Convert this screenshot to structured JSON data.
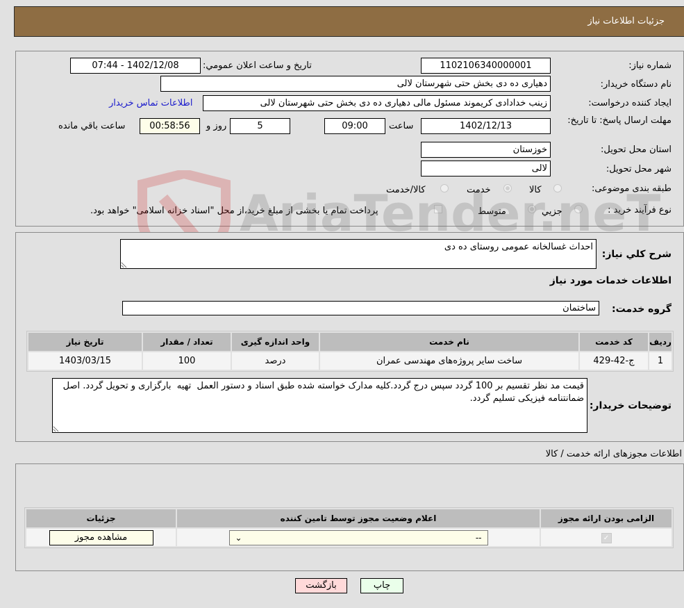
{
  "header": {
    "title": "جزئیات اطلاعات نیاز"
  },
  "details": {
    "need_number_label": "شماره نیاز:",
    "need_number": "1102106340000001",
    "announce_label": "تاریخ و ساعت اعلان عمومي:",
    "announce_value": "1402/12/08 - 07:44",
    "buyer_org_label": "نام دستگاه خریدار:",
    "buyer_org": "دهیاری ده دی بخش حتی شهرستان لالی",
    "creator_label": "ایجاد کننده درخواست:",
    "creator": "زینب خدادادی کریموند مسئول مالی دهیاری ده دی بخش حتی شهرستان لالی",
    "contact_link": "اطلاعات تماس خریدار",
    "deadline_label": "مهلت ارسال پاسخ: تا تاریخ:",
    "deadline_date": "1402/12/13",
    "time_label": "ساعت",
    "deadline_time": "09:00",
    "days_value": "5",
    "days_label": "روز و",
    "remaining_time": "00:58:56",
    "remaining_label": "ساعت باقي مانده",
    "province_label": "استان محل تحویل:",
    "province": "خوزستان",
    "city_label": "شهر محل تحویل:",
    "city": "لالی",
    "category_label": "طبقه بندی موضوعی:",
    "category_options": [
      "کالا",
      "خدمت",
      "کالا/خدمت"
    ],
    "category_selected": "خدمت",
    "process_label": "نوع فرآیند خرید :",
    "process_options": [
      "جزيي",
      "متوسط"
    ],
    "process_selected": "متوسط",
    "treasury_note": "پرداخت تمام یا بخشی از مبلغ خرید،از محل \"اسناد خزانه اسلامی\" خواهد بود."
  },
  "description": {
    "label": "شرح كلي نياز:",
    "value": "احداث غسالخانه عمومی روستای ده دی"
  },
  "services": {
    "section_title": "اطلاعات خدمات مورد نیاز",
    "group_label": "گروه خدمت:",
    "group_value": "ساختمان",
    "columns": [
      "ردیف",
      "کد خدمت",
      "نام خدمت",
      "واحد اندازه گیری",
      "تعداد / مقدار",
      "تاریخ نیاز"
    ],
    "rows": [
      {
        "index": "1",
        "code": "ج-42-429",
        "name": "ساخت سایر پروژه‌های مهندسی عمران",
        "unit": "درصد",
        "qty": "100",
        "date": "1403/03/15"
      }
    ]
  },
  "buyer_notes": {
    "label": "توضیحات خریدار:",
    "value": "قیمت مد نظر تقسیم بر 100 گردد سپس درج گردد.کلیه مدارک خواسته شده طبق اسناد و دستور العمل  تهیه  بارگزاری و تحویل گردد. اصل ضمانتنامه فیزیکی تسلیم گردد."
  },
  "licenses": {
    "section_title": "اطلاعات مجوزهای ارائه خدمت / کالا",
    "columns": [
      "الزامی بودن ارائه مجوز",
      "اعلام وضعیت مجوز توسط تامین کننده",
      "جزئیات"
    ],
    "rows": [
      {
        "required": true,
        "status_selected": "--",
        "details_button": "مشاهده مجوز"
      }
    ]
  },
  "footer": {
    "print_label": "چاپ",
    "back_label": "بازگشت"
  },
  "watermark": {
    "text": "AriaTender.neT"
  },
  "colors": {
    "header_bg": "#8e6d43",
    "link": "#1a1acc",
    "back_btn": "#ffd9d9",
    "print_btn": "#eaffea",
    "yellow_field": "#fdfde9"
  }
}
